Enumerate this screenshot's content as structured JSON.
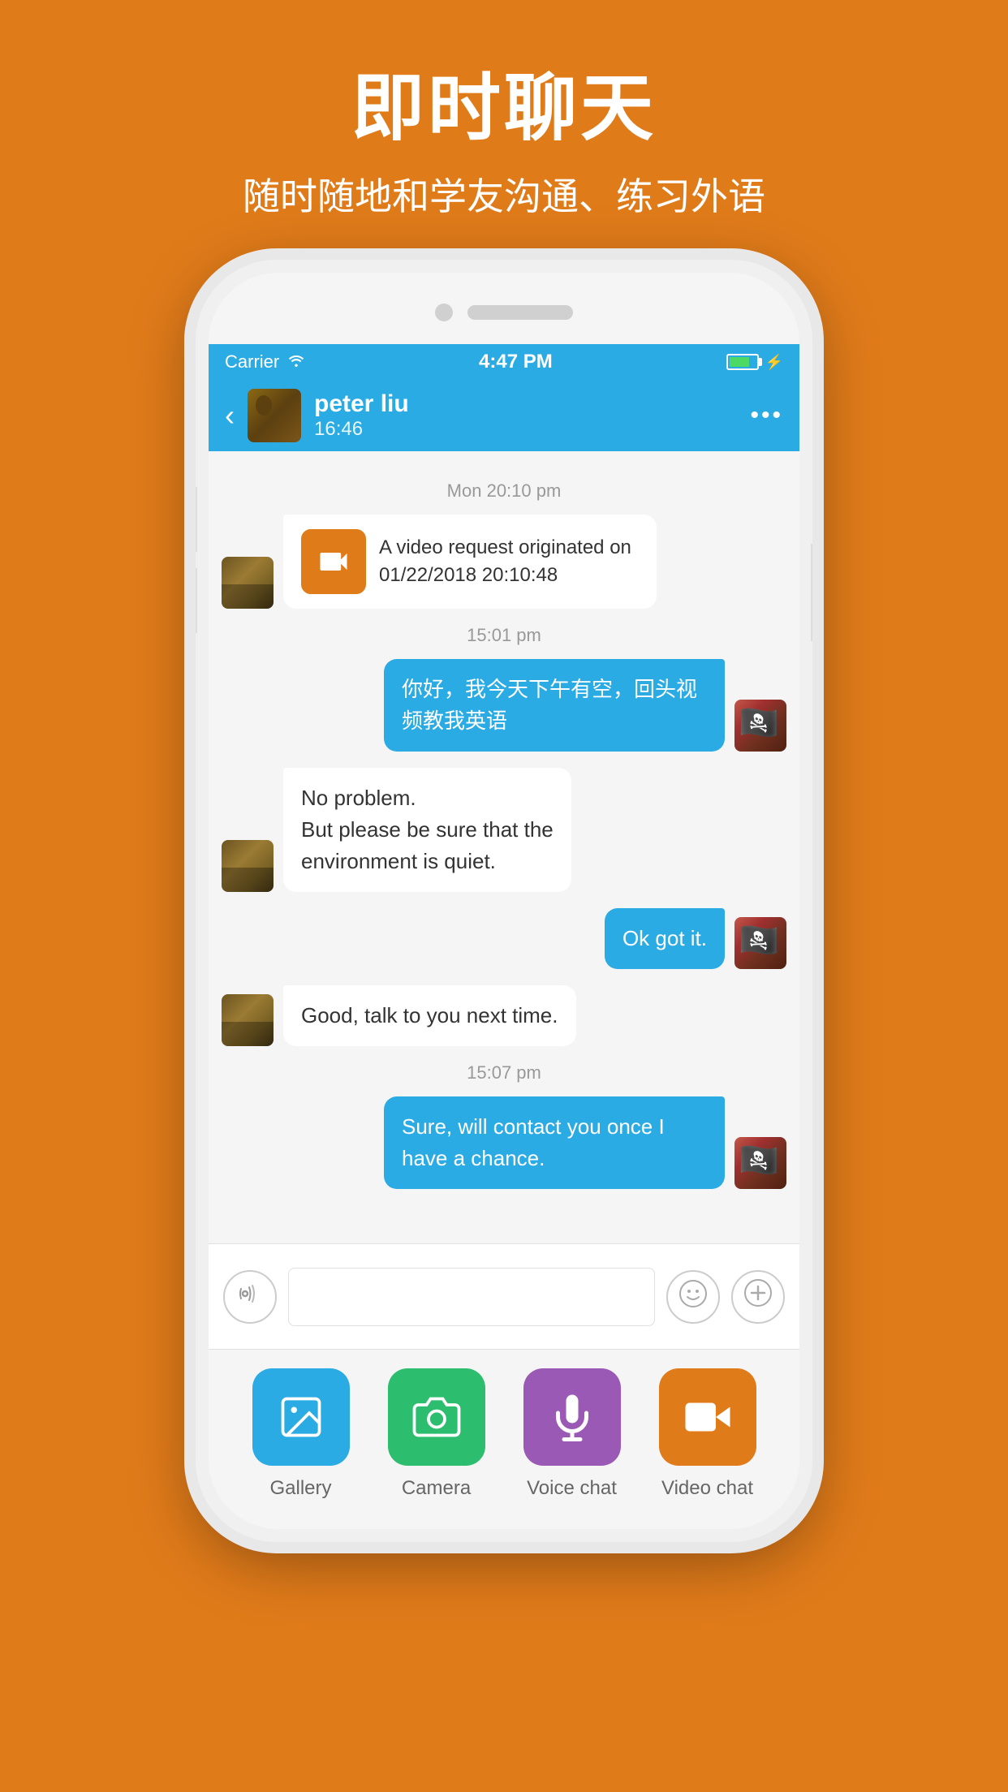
{
  "page": {
    "background_color": "#E07B1A",
    "title": "即时聊天",
    "subtitle": "随时随地和学友沟通、练习外语"
  },
  "status_bar": {
    "carrier": "Carrier",
    "time": "4:47 PM",
    "wifi": true,
    "battery": true
  },
  "chat_header": {
    "back_label": "‹",
    "contact_name": "peter liu",
    "contact_time": "16:46",
    "more_label": "•••"
  },
  "messages": [
    {
      "type": "timestamp",
      "text": "Mon 20:10 pm"
    },
    {
      "type": "received",
      "content_type": "video_request",
      "text": "A video request originated on 01/22/2018 20:10:48"
    },
    {
      "type": "timestamp",
      "text": "15:01 pm"
    },
    {
      "type": "sent",
      "text": "你好，我今天下午有空，回头视频教我英语"
    },
    {
      "type": "received",
      "text": "No  problem.\nBut  please be sure that the\nenvironment is  quiet."
    },
    {
      "type": "sent",
      "text": "Ok got it."
    },
    {
      "type": "received",
      "text": "Good, talk  to you next time."
    },
    {
      "type": "timestamp",
      "text": "15:07 pm"
    },
    {
      "type": "sent",
      "text": "Sure, will contact you once I have a chance."
    }
  ],
  "input_bar": {
    "placeholder": "",
    "voice_label": "voice",
    "emoji_label": "😊",
    "add_label": "+"
  },
  "toolbar": {
    "items": [
      {
        "label": "Gallery",
        "icon": "gallery-icon",
        "color": "#2AABE4"
      },
      {
        "label": "Camera",
        "icon": "camera-icon",
        "color": "#2DBD6E"
      },
      {
        "label": "Voice chat",
        "icon": "microphone-icon",
        "color": "#9B59B6"
      },
      {
        "label": "Video chat",
        "icon": "video-icon",
        "color": "#E07B1A"
      }
    ]
  }
}
